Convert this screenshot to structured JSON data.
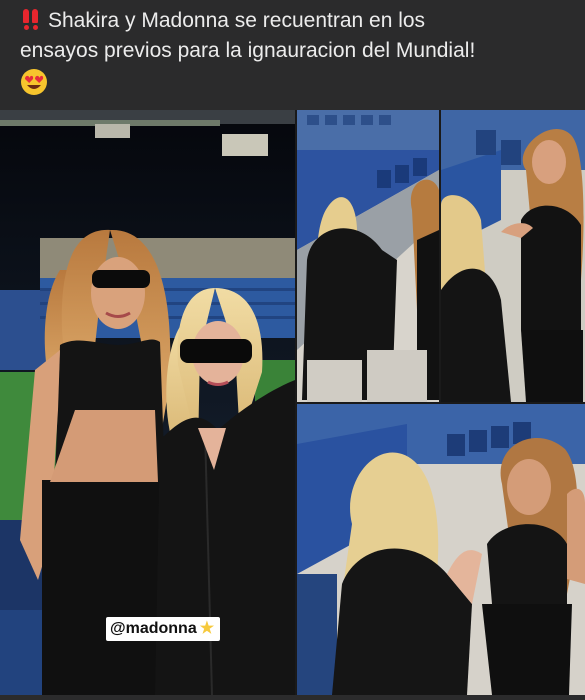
{
  "post": {
    "caption_line1": "Shakira y Madonna se recuentran en los",
    "caption_line2": "ensayos previos para la ignauracion del Mundial!",
    "emoji_alert": "double-exclamation-mark-icon",
    "emoji_end": "heart-eyes-face-icon"
  },
  "photo_main": {
    "mention_tag": "@madonna",
    "mention_emoji": "★"
  },
  "colors": {
    "caption_bg": "#2b2b2c",
    "caption_text": "#ececec",
    "alert_red": "#e8262e",
    "stadium_blue": "#2c5aa6"
  }
}
